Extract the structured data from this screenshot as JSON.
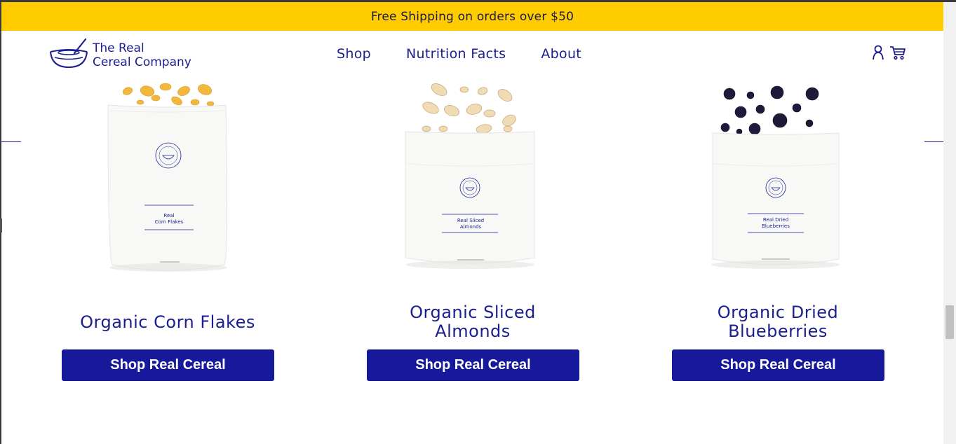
{
  "promo": {
    "text": "Free Shipping on orders over $50"
  },
  "header": {
    "logo_line1": "The Real",
    "logo_line2": "Cereal Company",
    "nav": [
      {
        "label": "Shop"
      },
      {
        "label": "Nutrition Facts"
      },
      {
        "label": "About"
      }
    ],
    "icons": [
      "user-icon",
      "cart-icon"
    ]
  },
  "products": [
    {
      "title_line1": "Organic Corn Flakes",
      "title_line2": "",
      "bag_label_line1": "Real",
      "bag_label_line2": "Corn Flakes",
      "button_label": "Shop Real Cereal"
    },
    {
      "title_line1": "Organic Sliced",
      "title_line2": "Almonds",
      "bag_label_line1": "Real Sliced",
      "bag_label_line2": "Almonds",
      "button_label": "Shop Real Cereal"
    },
    {
      "title_line1": "Organic Dried",
      "title_line2": "Blueberries",
      "bag_label_line1": "Real Dried",
      "bag_label_line2": "Blueberries",
      "button_label": "Shop Real Cereal"
    }
  ],
  "colors": {
    "promo_bg": "#ffcc00",
    "brand_navy": "#1a1e8f",
    "button_bg": "#16199a"
  }
}
